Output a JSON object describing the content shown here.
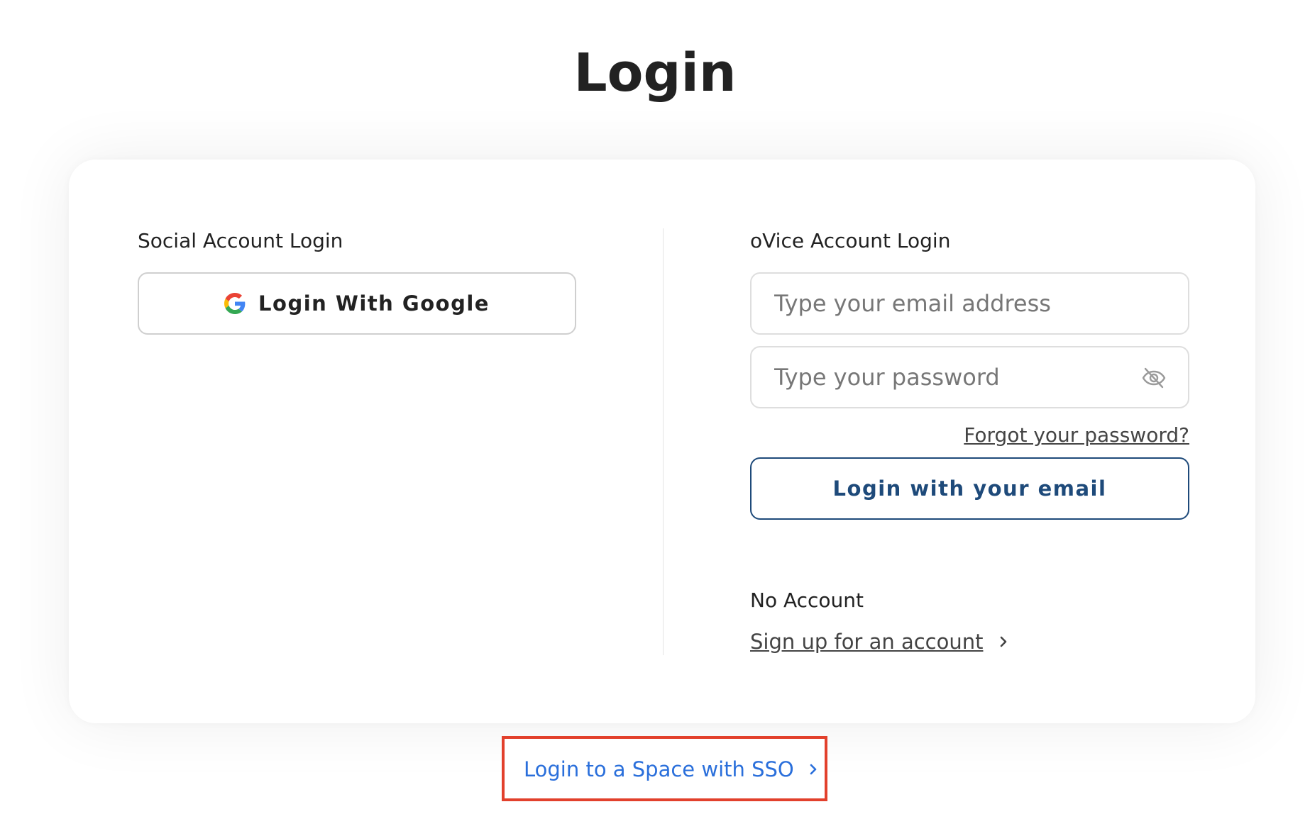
{
  "page": {
    "title": "Login"
  },
  "social": {
    "heading": "Social Account Login",
    "google_button_label": "Login With Google"
  },
  "ovice": {
    "heading": "oVice Account Login",
    "email_placeholder": "Type your email address",
    "email_value": "",
    "password_placeholder": "Type your password",
    "password_value": "",
    "forgot_password_label": "Forgot your password?",
    "login_email_button_label": "Login with your email"
  },
  "no_account": {
    "heading": "No Account",
    "signup_label": "Sign up for an account"
  },
  "sso": {
    "label": "Login to a Space with SSO"
  },
  "icons": {
    "google": "google-g-icon",
    "password_toggle": "eye-off-icon",
    "chevron": "chevron-right-icon"
  },
  "colors": {
    "primary_button_border": "#1e4a7a",
    "link_blue": "#2a6fdb",
    "highlight_box": "#e2402c"
  }
}
